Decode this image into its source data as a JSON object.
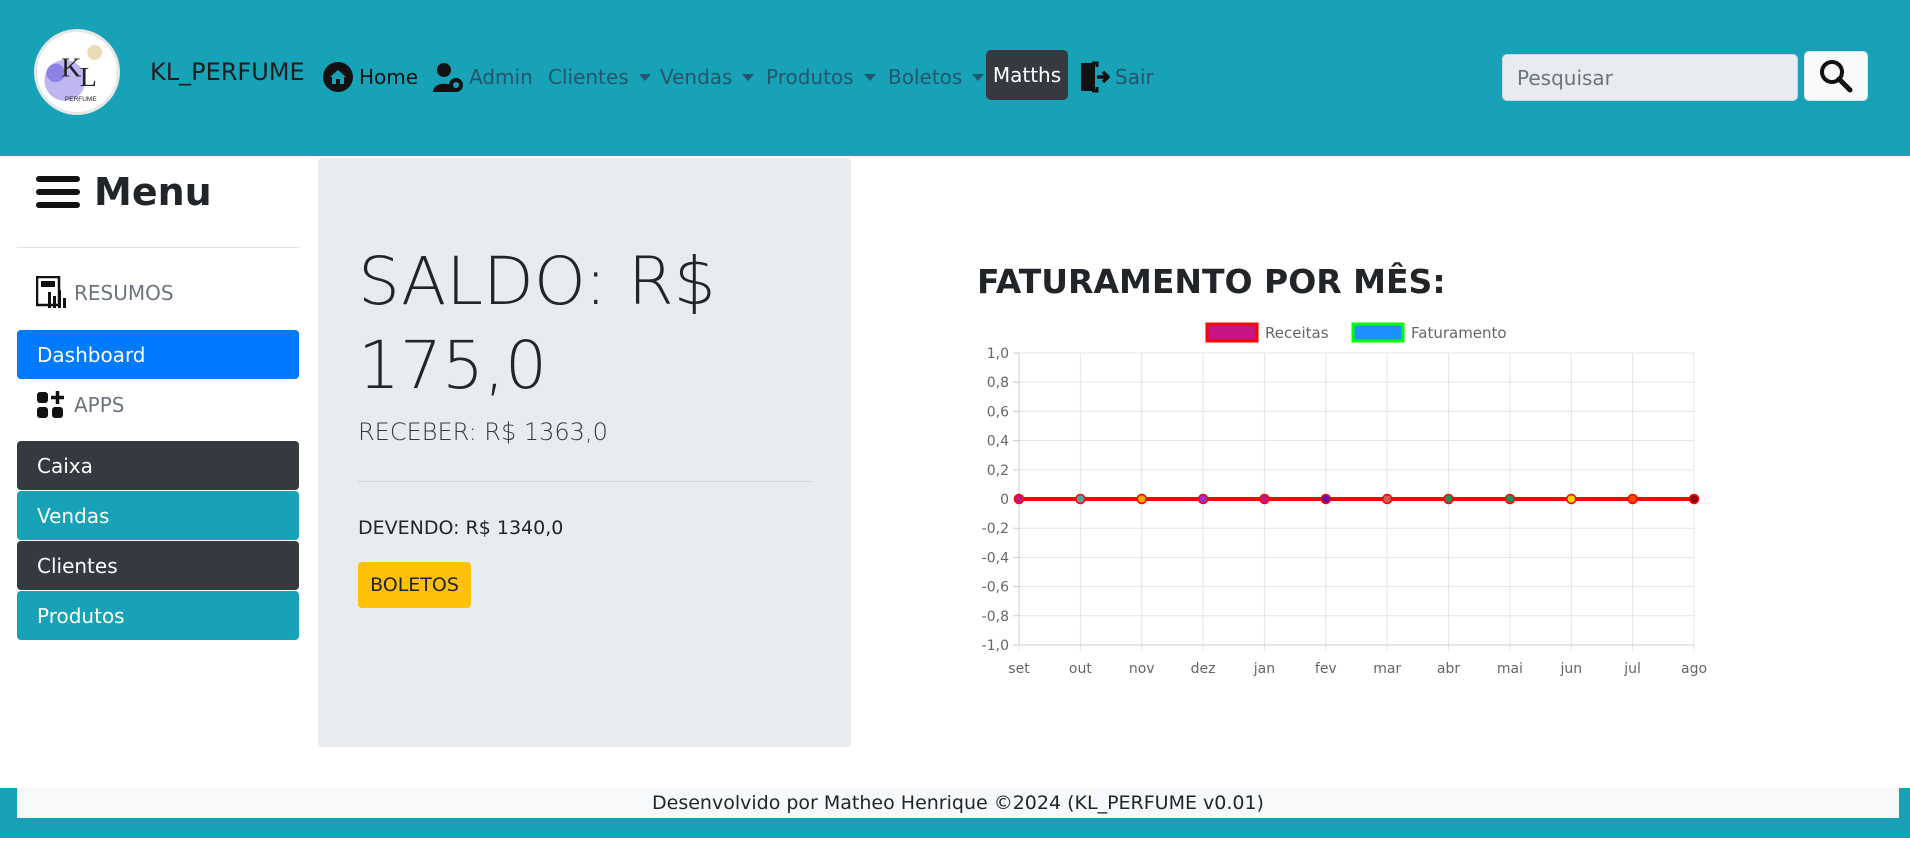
{
  "brand": {
    "name": "KL_PERFUME",
    "logo_text": "KL",
    "logo_subtext": "PERFUME"
  },
  "nav": {
    "home": "Home",
    "admin": "Admin",
    "clientes": "Clientes",
    "vendas": "Vendas",
    "produtos": "Produtos",
    "boletos": "Boletos",
    "matths": "Matths",
    "sair": "Sair",
    "search_placeholder": "Pesquisar",
    "icons": [
      "home-icon",
      "admin-gear-icon",
      "search-icon",
      "exit-icon"
    ]
  },
  "sidebar": {
    "title": "Menu",
    "sections": [
      {
        "label": "RESUMOS",
        "icon": "report-icon",
        "items": [
          {
            "label": "Dashboard",
            "style": "primary"
          }
        ]
      },
      {
        "label": "APPS",
        "icon": "apps-add-icon",
        "items": [
          {
            "label": "Caixa",
            "style": "dark"
          },
          {
            "label": "Vendas",
            "style": "info"
          },
          {
            "label": "Clientes",
            "style": "dark"
          },
          {
            "label": "Produtos",
            "style": "info"
          }
        ]
      }
    ]
  },
  "summary": {
    "saldo": "SALDO: R$ 175,0",
    "receber": "RECEBER: R$ 1363,0",
    "devendo": "DEVENDO: R$ 1340,0",
    "boletos_button": "BOLETOS"
  },
  "chart_data": {
    "type": "line",
    "title": "FATURAMENTO POR MÊS:",
    "categories": [
      "set",
      "out",
      "nov",
      "dez",
      "jan",
      "fev",
      "mar",
      "abr",
      "mai",
      "jun",
      "jul",
      "ago"
    ],
    "series": [
      {
        "name": "Receitas",
        "values": [
          0,
          0,
          0,
          0,
          0,
          0,
          0,
          0,
          0,
          0,
          0,
          0
        ]
      },
      {
        "name": "Faturamento",
        "values": [
          0,
          0,
          0,
          0,
          0,
          0,
          0,
          0,
          0,
          0,
          0,
          0
        ]
      }
    ],
    "ylim": [
      -1.0,
      1.0
    ],
    "yticks": [
      "1,0",
      "0,8",
      "0,6",
      "0,4",
      "0,2",
      "0",
      "-0,2",
      "-0,4",
      "-0,6",
      "-0,8",
      "-1,0"
    ],
    "grid": true,
    "legend": "top",
    "line_color": "#ff0000",
    "legend_colors": {
      "Receitas": {
        "fill": "#c71585",
        "border": "#ff0000"
      },
      "Faturamento": {
        "fill": "#1e90ff",
        "border": "#00ff00"
      }
    },
    "point_colors": [
      "#c71585",
      "#5f9ea0",
      "#ffa500",
      "#9932cc",
      "#c71585",
      "#6a0dad",
      "#cd5c5c",
      "#2e8b57",
      "#2e8b57",
      "#ffd700",
      "#ff4500",
      "#8b0000"
    ]
  },
  "footer": {
    "text": "Desenvolvido por Matheo Henrique ©2024 (KL_PERFUME v0.01)"
  },
  "colors": {
    "navbar": "#17a2b8",
    "primary": "#007bff",
    "dark": "#343a40",
    "warning": "#ffc107"
  }
}
